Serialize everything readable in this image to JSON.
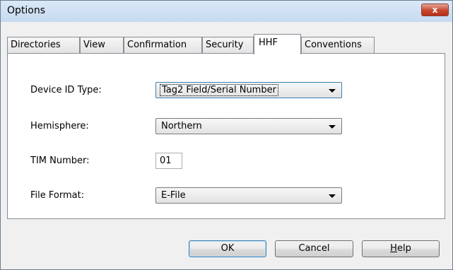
{
  "window": {
    "title": "Options",
    "close_symbol": "x"
  },
  "tabs": [
    {
      "label": "Directories"
    },
    {
      "label": "View"
    },
    {
      "label": "Confirmation"
    },
    {
      "label": "Security"
    },
    {
      "label": "HHF"
    },
    {
      "label": "Conventions"
    }
  ],
  "active_tab": "HHF",
  "form": {
    "device_id_type": {
      "label": "Device ID Type:",
      "value": "Tag2 Field/Serial Number"
    },
    "hemisphere": {
      "label": "Hemisphere:",
      "value": "Northern"
    },
    "tim_number": {
      "label": "TIM Number:",
      "value": "01"
    },
    "file_format": {
      "label": "File Format:",
      "value": "E-File"
    }
  },
  "buttons": {
    "ok": "OK",
    "cancel": "Cancel",
    "help_prefix": "H",
    "help_rest": "elp"
  }
}
